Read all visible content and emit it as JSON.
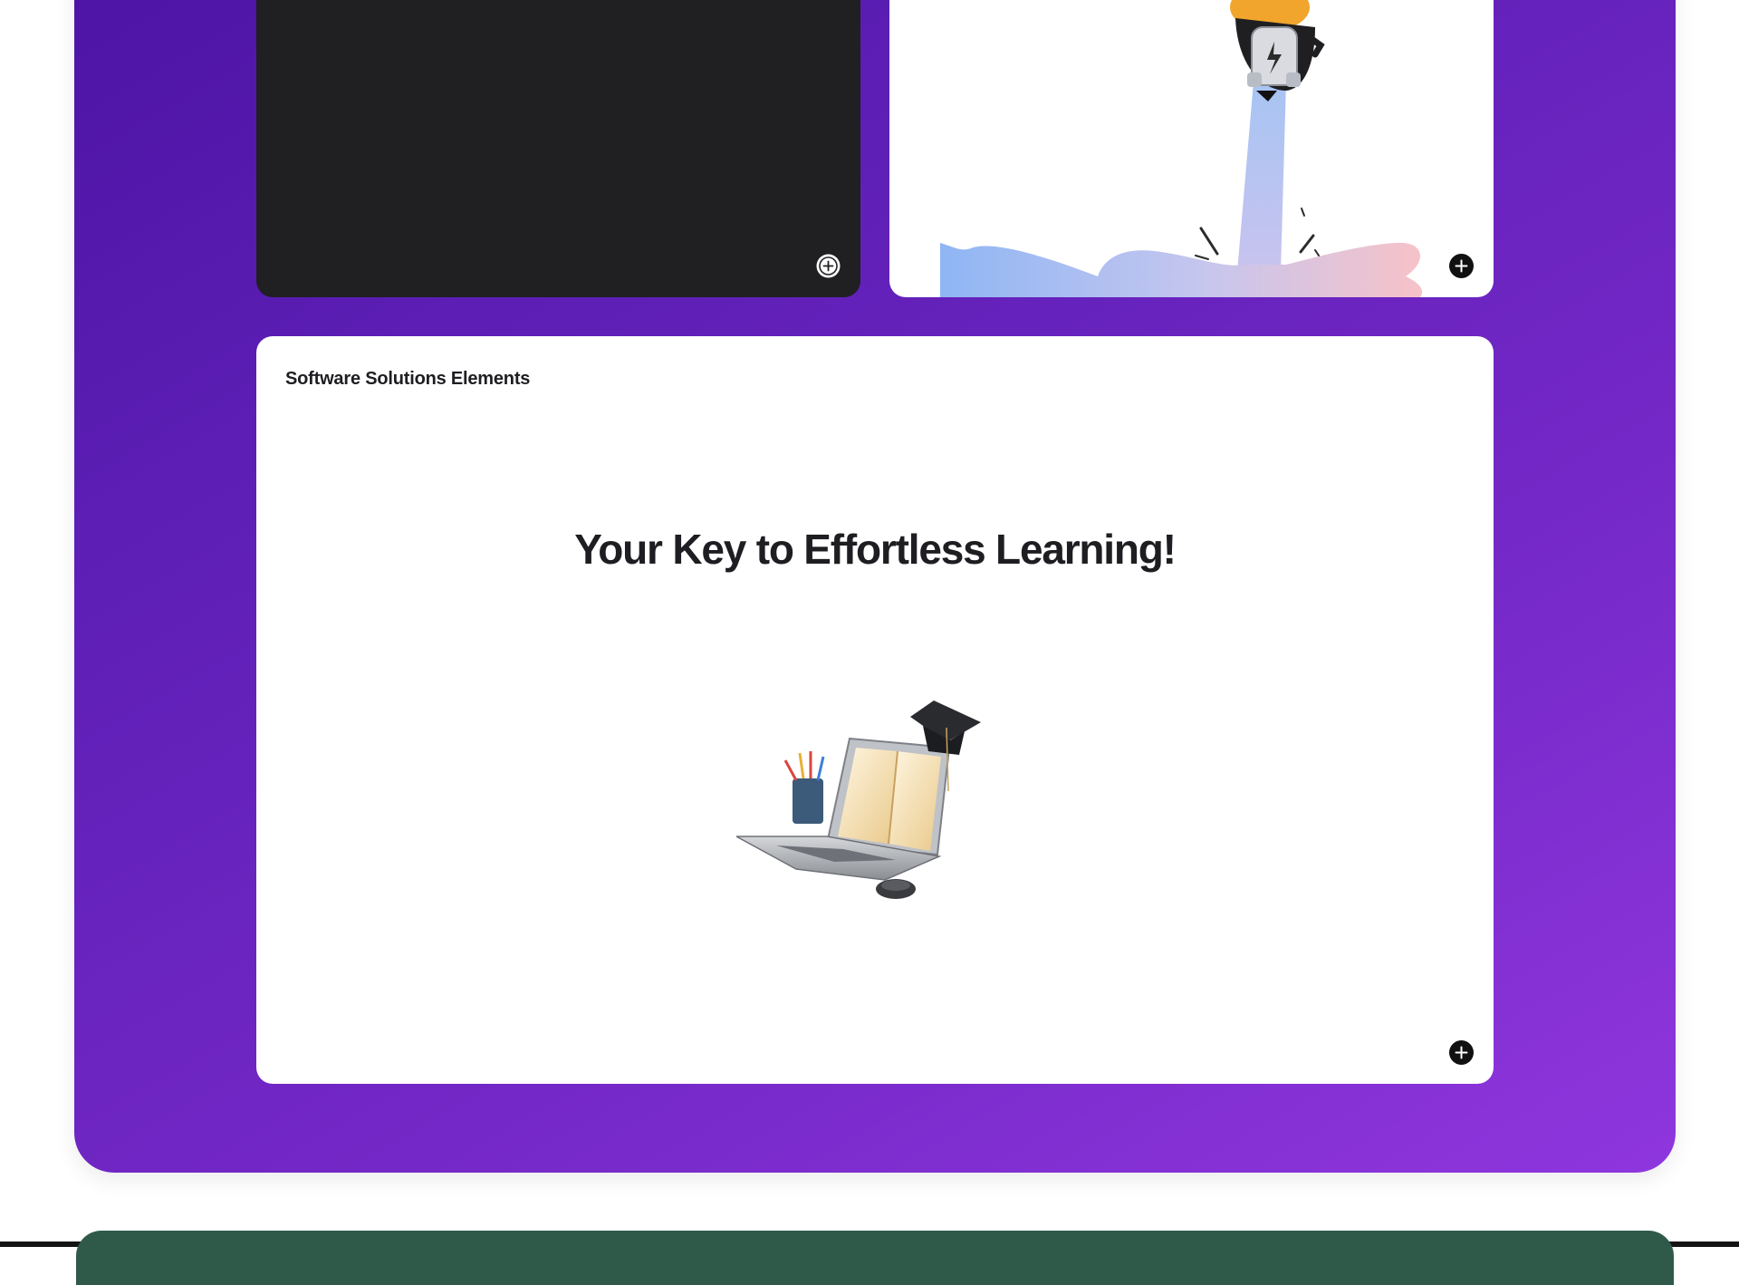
{
  "section": {
    "accent_gradient": [
      "#4c14a4",
      "#8f36de"
    ]
  },
  "cards": {
    "dark_card": {
      "background": "#201f22",
      "action_icon": "plus-circle-icon"
    },
    "hero_card": {
      "illustration": "jetpack-character-illustration",
      "action_icon": "plus-circle-icon"
    },
    "software_card": {
      "label": "Software Solutions Elements",
      "heading": "Your Key to Effortless Learning!",
      "illustration": "laptop-book-graduation-cap-illustration",
      "action_icon": "plus-circle-icon"
    }
  },
  "footer": {
    "next_section_color": "#2f5a4a"
  }
}
